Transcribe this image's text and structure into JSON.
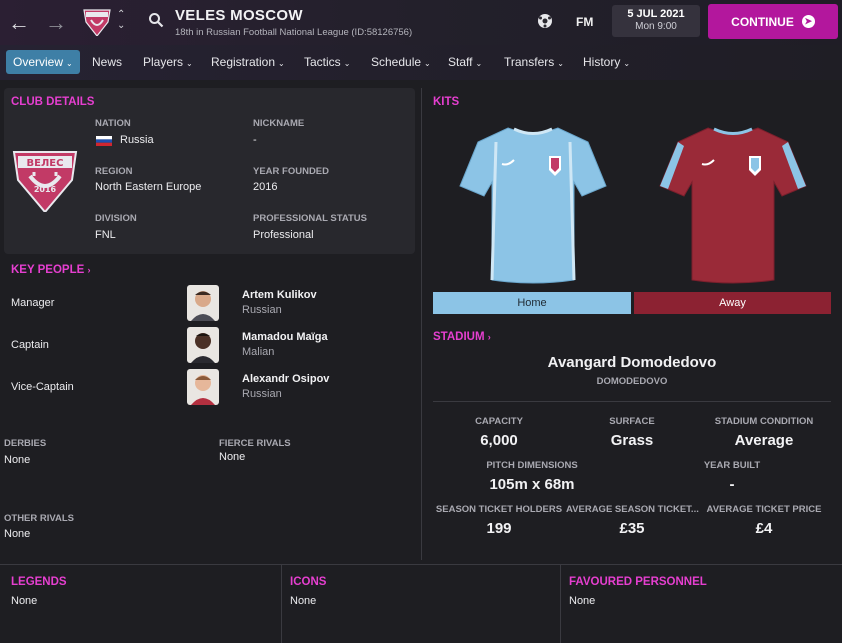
{
  "header": {
    "club_name": "VELES MOSCOW",
    "club_subtitle": "18th in Russian Football National League (ID:58126756)",
    "fm_label": "FM",
    "date": "5 JUL 2021",
    "time": "Mon 9:00",
    "continue_label": "CONTINUE"
  },
  "menu": {
    "items": [
      {
        "label": "Overview",
        "active": true
      },
      {
        "label": "News"
      },
      {
        "label": "Players"
      },
      {
        "label": "Registration"
      },
      {
        "label": "Tactics"
      },
      {
        "label": "Schedule"
      },
      {
        "label": "Staff"
      },
      {
        "label": "Transfers"
      },
      {
        "label": "History"
      }
    ]
  },
  "club_details": {
    "title": "CLUB DETAILS",
    "crest_text": "ВЕЛЕС",
    "crest_year": "2016",
    "nation_label": "NATION",
    "nation_value": "Russia",
    "nickname_label": "NICKNAME",
    "nickname_value": "-",
    "region_label": "REGION",
    "region_value": "North Eastern Europe",
    "year_founded_label": "YEAR FOUNDED",
    "year_founded_value": "2016",
    "division_label": "DIVISION",
    "division_value": "FNL",
    "pro_status_label": "PROFESSIONAL STATUS",
    "pro_status_value": "Professional"
  },
  "key_people": {
    "title": "KEY PEOPLE",
    "people": [
      {
        "role": "Manager",
        "name": "Artem Kulikov",
        "nationality": "Russian"
      },
      {
        "role": "Captain",
        "name": "Mamadou Maïga",
        "nationality": "Malian"
      },
      {
        "role": "Vice-Captain",
        "name": "Alexandr Osipov",
        "nationality": "Russian"
      }
    ]
  },
  "rivals": {
    "derbies_label": "DERBIES",
    "derbies_value": "None",
    "fierce_label": "FIERCE RIVALS",
    "fierce_value": "None",
    "other_label": "OTHER RIVALS",
    "other_value": "None"
  },
  "kits": {
    "title": "KITS",
    "home_label": "Home",
    "away_label": "Away",
    "home_color": "#8cc4e6",
    "away_color": "#9a2a38"
  },
  "stadium": {
    "title": "STADIUM",
    "name": "Avangard Domodedovo",
    "location": "DOMODEDOVO",
    "capacity_label": "CAPACITY",
    "capacity_value": "6,000",
    "surface_label": "SURFACE",
    "surface_value": "Grass",
    "condition_label": "STADIUM CONDITION",
    "condition_value": "Average",
    "pitch_label": "PITCH DIMENSIONS",
    "pitch_value": "105m x 68m",
    "built_label": "YEAR BUILT",
    "built_value": "-",
    "holders_label": "SEASON TICKET HOLDERS",
    "holders_value": "199",
    "avg_season_label": "AVERAGE SEASON TICKET...",
    "avg_season_value": "£35",
    "avg_ticket_label": "AVERAGE TICKET PRICE",
    "avg_ticket_value": "£4"
  },
  "bottom": {
    "legends_label": "LEGENDS",
    "legends_value": "None",
    "icons_label": "ICONS",
    "icons_value": "None",
    "favoured_label": "FAVOURED PERSONNEL",
    "favoured_value": "None"
  },
  "colors": {
    "accent": "#e63fd0",
    "continue": "#b3179d",
    "active_tab": "#3e7fa6"
  }
}
